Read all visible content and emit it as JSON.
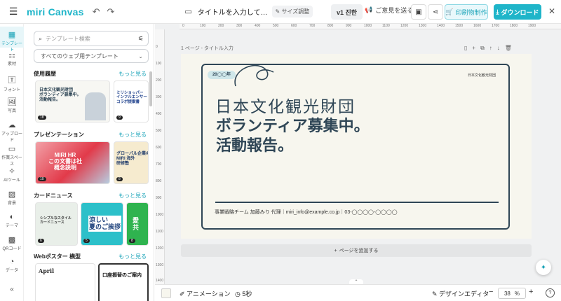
{
  "app": {
    "logo": "miri Canvas"
  },
  "toolbar": {
    "document_title": "タイトルを入力して…",
    "resize_label": "サイズ調整",
    "version_label": "v1 진한",
    "feedback_label": "ご意見を送る",
    "print_label": "印刷物制作",
    "download_label": "ダウンロード"
  },
  "rail": {
    "items": [
      {
        "label": "テンプレート",
        "icon": "template-icon"
      },
      {
        "label": "素材",
        "icon": "elements-icon"
      },
      {
        "label": "フォント",
        "icon": "text-icon"
      },
      {
        "label": "写真",
        "icon": "photo-icon"
      },
      {
        "label": "アップロード",
        "icon": "upload-icon"
      },
      {
        "label": "作業スペース",
        "icon": "folder-icon"
      },
      {
        "label": "AIツール",
        "icon": "ai-icon"
      },
      {
        "label": "背景",
        "icon": "background-icon"
      },
      {
        "label": "テーマ",
        "icon": "palette-icon"
      },
      {
        "label": "QRコード",
        "icon": "qr-icon"
      },
      {
        "label": "データ",
        "icon": "data-icon"
      }
    ]
  },
  "panel": {
    "search_placeholder": "テンプレート検索",
    "select_value": "すべてのウェブ用テンプレート",
    "more_label": "もっと見る",
    "sections": [
      {
        "title": "使用履歴",
        "thumbs": [
          {
            "badge": "18",
            "text": "日本文化観光財団\nボランティア募集中。\n活動報告。"
          },
          {
            "badge": "9",
            "text": "ミリショッパー\nインフルエンサー\nコラボ提案書"
          }
        ]
      },
      {
        "title": "プレゼンテーション",
        "thumbs": [
          {
            "badge": "10",
            "text": "MIRI HR\nこの文書は社\n概念説明"
          },
          {
            "badge": "8",
            "text": "グローバル企業の取組\nMIRI 海外\n研修塾"
          }
        ]
      },
      {
        "title": "カードニュース",
        "thumbs": [
          {
            "badge": "6",
            "text": "シンプルなスタイル\nカードニュース"
          },
          {
            "badge": "5",
            "text": "涼しい\n夏のご挨拶"
          },
          {
            "badge": "8",
            "text": "愛\n共"
          }
        ]
      },
      {
        "title": "Webポスター 横型",
        "thumbs": [
          {
            "badge": "",
            "text": "April"
          },
          {
            "badge": "",
            "text": "口座振替のご案内"
          }
        ]
      }
    ]
  },
  "editor": {
    "page_label": "1 ページ - タイトル入力",
    "add_page_label": "ページを追加する",
    "ruler_top": [
      "0",
      "100",
      "200",
      "300",
      "400",
      "500",
      "600",
      "700",
      "800",
      "900",
      "1000",
      "1100",
      "1200",
      "1300",
      "1400",
      "1500",
      "1600",
      "1700",
      "1800",
      "1900"
    ],
    "ruler_left": [
      "0",
      "100",
      "200",
      "300",
      "400",
      "500",
      "600",
      "700",
      "800",
      "900",
      "1000",
      "1100",
      "1200",
      "1300",
      "1400"
    ]
  },
  "design": {
    "year_pill": "20◯◯年",
    "org_small": "日本文化観光財団",
    "org_big": "日本文化観光財団",
    "headline_1": "ボランティア募集中。",
    "headline_2": "活動報告。",
    "contact": "事業戦略チーム 加藤みり 代理｜miri_info@example.co.jp｜03-◯◯◯◯-◯◯◯◯"
  },
  "bottom": {
    "animation_label": "アニメーション",
    "time_label": "5秒",
    "design_editor_label": "デザインエディタ",
    "zoom_value": "38",
    "zoom_unit": "%"
  },
  "colors": {
    "accent": "#1fb5c9",
    "frame": "#2f4656",
    "canvas_bg": "#f7f6ee"
  }
}
